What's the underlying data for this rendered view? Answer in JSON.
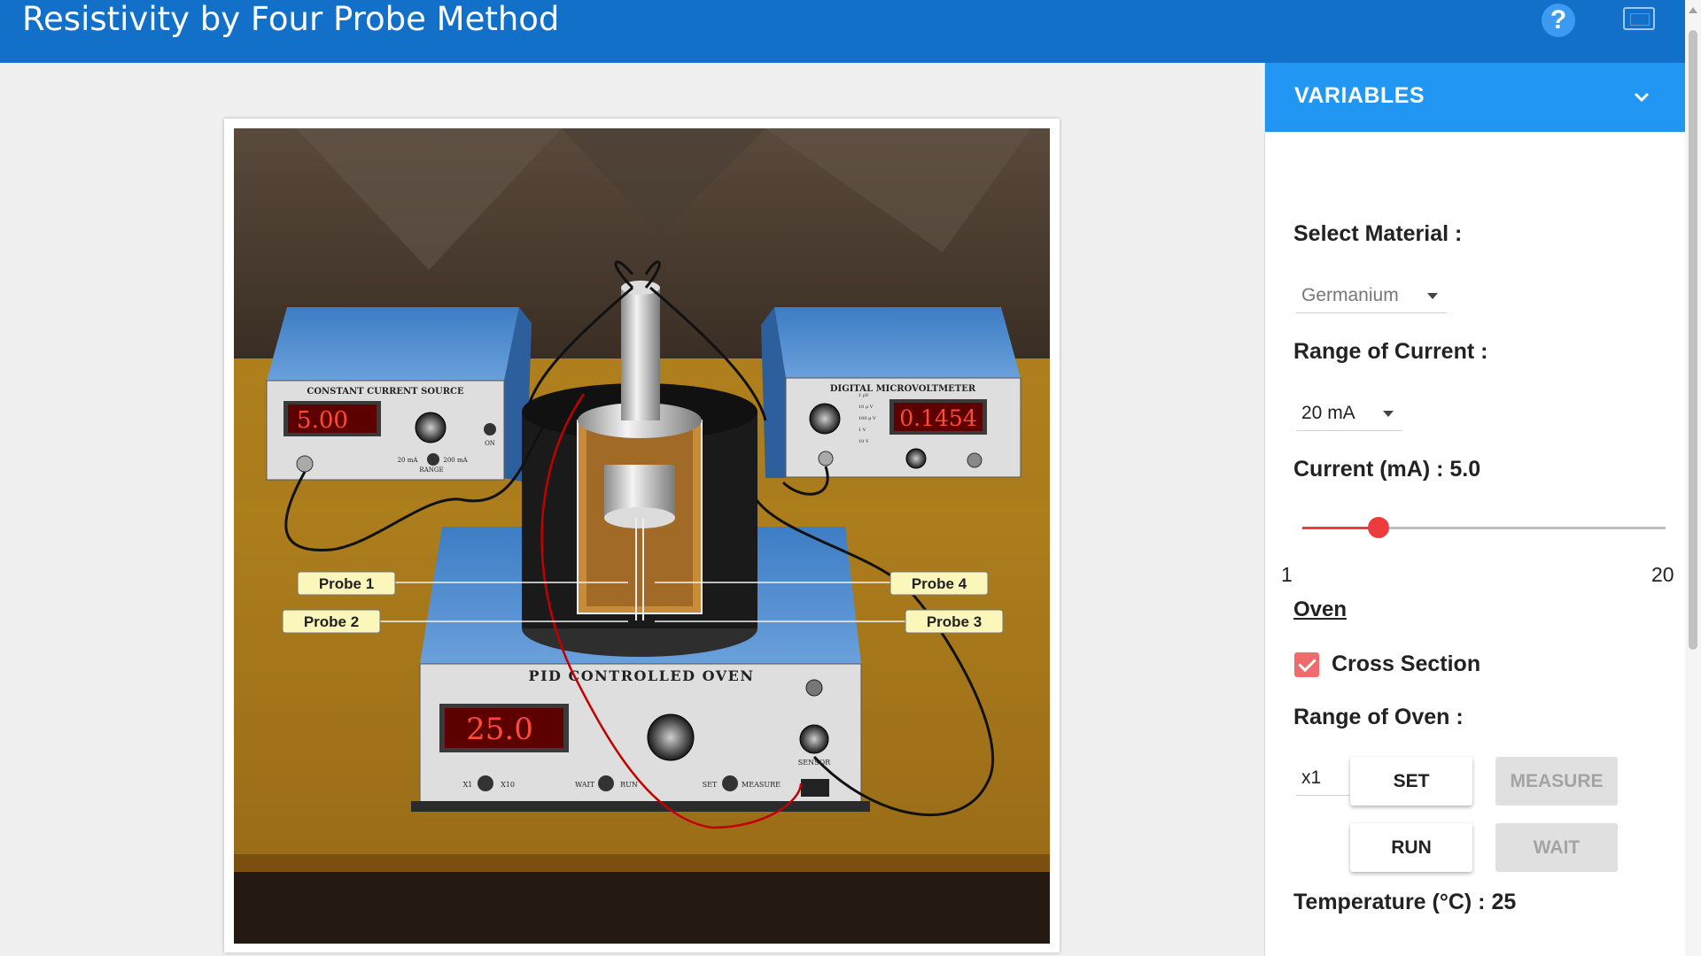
{
  "app": {
    "title": "Resistivity by Four Probe Method"
  },
  "header": {
    "help_label": "?"
  },
  "simulation": {
    "current_source": {
      "title": "CONSTANT CURRENT SOURCE",
      "display": "5.00",
      "range_left": "20 mA",
      "range_right": "200 mA",
      "range_label": "RANGE",
      "on_label": "ON"
    },
    "microvoltmeter": {
      "title": "DIGITAL MICROVOLTMETER",
      "display": "0.1454",
      "ranges": [
        "1 μV",
        "10 μ V",
        "100 μ V",
        "1 V",
        "10 V"
      ]
    },
    "oven": {
      "title": "PID CONTROLLED OVEN",
      "display": "25.0",
      "x1": "X1",
      "x10": "X10",
      "wait": "WAIT",
      "run": "RUN",
      "set": "SET",
      "measure": "MEASURE",
      "sensor": "SENSOR"
    },
    "probes": [
      "Probe 1",
      "Probe 2",
      "Probe 3",
      "Probe 4"
    ]
  },
  "panel": {
    "title": "VARIABLES",
    "material_label": "Select Material :",
    "material_value": "Germanium",
    "range_current_label": "Range of Current :",
    "range_current_value": "20 mA",
    "current_label": "Current (mA) : 5.0",
    "current": {
      "min": 1,
      "max": 20,
      "value": 5.0,
      "min_label": "1",
      "max_label": "20"
    },
    "oven_link": "Oven",
    "cross_section_label": "Cross Section",
    "cross_section_checked": true,
    "range_oven_label": "Range of Oven :",
    "range_oven_value": "x1",
    "buttons": {
      "set": "SET",
      "measure": "MEASURE",
      "run": "RUN",
      "wait": "WAIT"
    },
    "temperature_label": "Temperature (°C) : 25"
  }
}
